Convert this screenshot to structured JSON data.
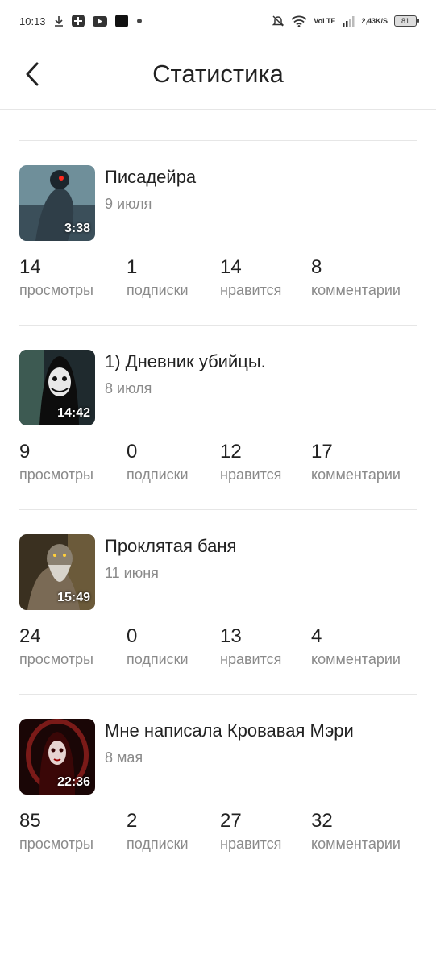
{
  "status_bar": {
    "time": "10:13",
    "network_speed": "2,43",
    "network_unit": "K/S",
    "network_type_top": "Vo",
    "network_type_bottom": "LTE",
    "battery": "81"
  },
  "header": {
    "title": "Статистика"
  },
  "stat_labels": [
    "просмотры",
    "подписки",
    "нравится",
    "комментарии"
  ],
  "videos": [
    {
      "title": "Писадейра",
      "date": "9 июля",
      "duration": "3:38",
      "stats": [
        "14",
        "1",
        "14",
        "8"
      ],
      "thumb_color": "#5a7a86"
    },
    {
      "title": "1) Дневник убийцы.",
      "date": "8 июля",
      "duration": "14:42",
      "stats": [
        "9",
        "0",
        "12",
        "17"
      ],
      "thumb_color": "#2b2f33"
    },
    {
      "title": "Проклятая баня",
      "date": "11 июня",
      "duration": "15:49",
      "stats": [
        "24",
        "0",
        "13",
        "4"
      ],
      "thumb_color": "#5d4a2c"
    },
    {
      "title": "Мне написала Кровавая Мэри",
      "date": "8 мая",
      "duration": "22:36",
      "stats": [
        "85",
        "2",
        "27",
        "32"
      ],
      "thumb_color": "#5a1214"
    }
  ]
}
